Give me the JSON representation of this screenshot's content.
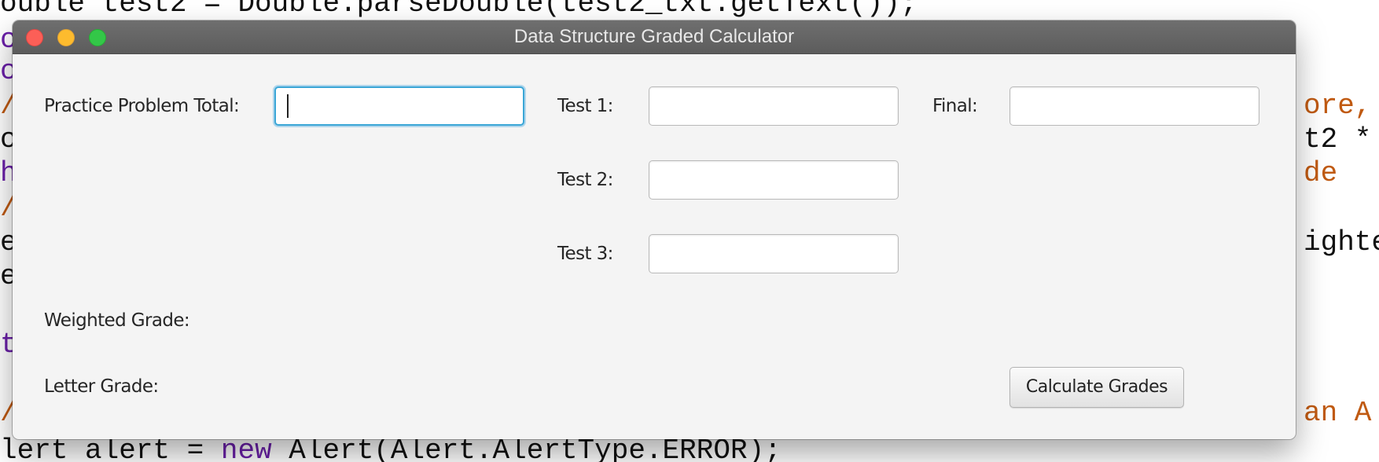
{
  "background_code": {
    "lines": [
      {
        "pre": "ouble test2 = Double.parseDouble(test2_txt.getText());",
        "kw": "",
        "post": ""
      },
      {
        "pre": "c",
        "kw": "",
        "post": ""
      },
      {
        "pre": "c",
        "kw": "",
        "post": ""
      },
      {
        "pre": "/",
        "kw": "",
        "post": ""
      },
      {
        "pre": "c",
        "kw": "",
        "post": ""
      },
      {
        "pre": "h",
        "kw": "",
        "post": ""
      },
      {
        "pre": "/",
        "kw": "",
        "post": ""
      },
      {
        "pre": "e",
        "kw": "",
        "post": ""
      },
      {
        "pre": "e",
        "kw": "",
        "post": ""
      },
      {
        "pre": "t",
        "kw": "",
        "post": ""
      },
      {
        "pre": "/",
        "kw": "",
        "post": ""
      },
      {
        "pre": "lert alert = ",
        "kw": "new",
        "post": " Alert(Alert.AlertType.ERROR);"
      }
    ],
    "right_fragments": [
      "ore,",
      "t2 *",
      "de",
      "ighte",
      "an A"
    ]
  },
  "window": {
    "title": "Data Structure Graded Calculator",
    "traffic_lights": {
      "close": "close-button",
      "minimize": "minimize-button",
      "maximize": "maximize-button"
    }
  },
  "form": {
    "practice_label": "Practice Problem Total:",
    "practice_value": "",
    "test1_label": "Test 1:",
    "test1_value": "",
    "test2_label": "Test 2:",
    "test2_value": "",
    "test3_label": "Test 3:",
    "test3_value": "",
    "final_label": "Final:",
    "final_value": "",
    "weighted_label": "Weighted Grade:",
    "letter_label": "Letter Grade:",
    "calculate_button": "Calculate Grades"
  },
  "colors": {
    "focus_ring": "#3aa6d6",
    "close": "#fc5f57",
    "minimize": "#fdbb2e",
    "maximize": "#33c748",
    "keyword": "#6a1fa8",
    "comment": "#c05a12"
  }
}
